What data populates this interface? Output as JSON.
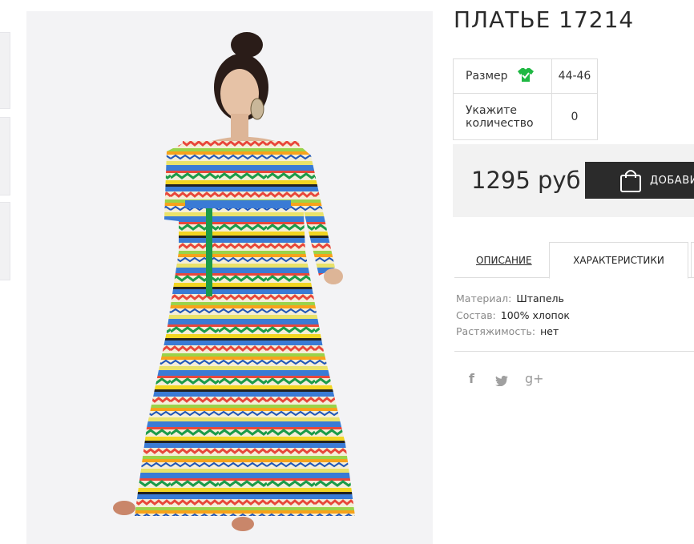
{
  "product": {
    "title": "ПЛАТЬЕ 17214",
    "image_alt": "Платье 17214"
  },
  "options": {
    "size_label": "Размер",
    "size_value": "44-46",
    "quantity_label_line1": "Укажите",
    "quantity_label_line2": "количество",
    "quantity_value": "0"
  },
  "price": {
    "text": "1295 руб",
    "add_button_label": "ДОБАВИТЬ"
  },
  "tabs": [
    {
      "label": "ОПИСАНИЕ",
      "active": false
    },
    {
      "label": "ХАРАКТЕРИСТИКИ",
      "active": true
    }
  ],
  "specs": [
    {
      "key": "Материал:",
      "value": "Штапель"
    },
    {
      "key": "Состав:",
      "value": "100% хлопок"
    },
    {
      "key": "Растяжимость:",
      "value": "нет"
    }
  ],
  "social": {
    "facebook": "f",
    "twitter": "twitter-icon",
    "google_plus": "g+"
  },
  "colors": {
    "button_bg": "#2b2b2b",
    "price_bg": "#f2f2f2",
    "size_icon": "#1fb843"
  }
}
